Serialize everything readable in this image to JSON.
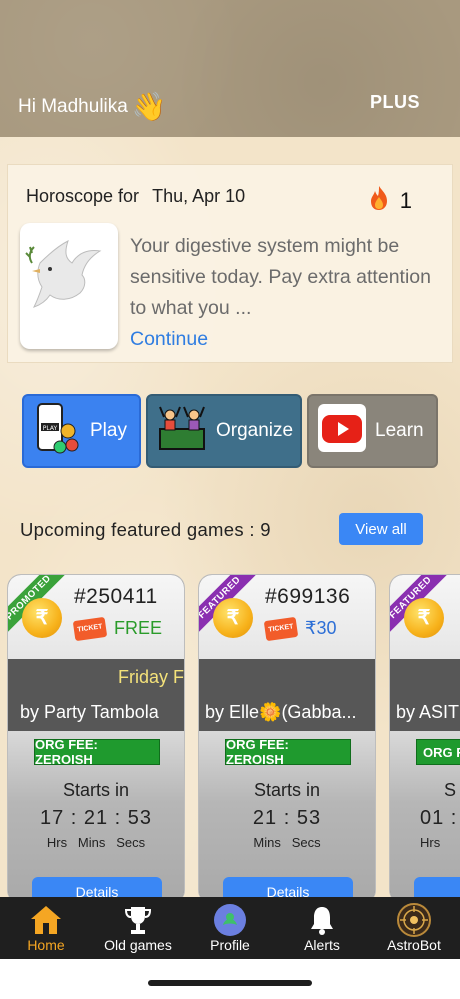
{
  "header": {
    "greeting": "Hi Madhulika",
    "wave": "👋",
    "plus_label": "PLUS"
  },
  "horoscope": {
    "title_prefix": "Horoscope for",
    "date": "Thu, Apr 10",
    "streak_icon": "fire-icon",
    "streak_count": "1",
    "text": "Your digestive system might be sensitive today. Pay extra attention to what you ...",
    "continue_label": "Continue"
  },
  "actions": [
    {
      "label": "Play",
      "icon": "play-phone-icon",
      "color": "#3b82f0"
    },
    {
      "label": "Organize",
      "icon": "organize-crowd-icon",
      "color": "#3f6f8a"
    },
    {
      "label": "Learn",
      "icon": "youtube-icon",
      "color": "#8a857b"
    }
  ],
  "upcoming": {
    "title": "Upcoming featured games : 9",
    "view_all_label": "View all"
  },
  "cards": [
    {
      "ribbon": "PROMOTED",
      "id": "#250411",
      "price": "FREE",
      "name": "Friday F",
      "host": "by Party Tambola",
      "org_fee": "ORG FEE: ZEROISH",
      "starts_label": "Starts in",
      "timer": "17 : 21 : 53",
      "units": "Hrs   Mins   Secs",
      "details_label": "Details"
    },
    {
      "ribbon": "FEATURED",
      "id": "#699136",
      "price": "₹30",
      "name": "",
      "host": "by Elle🌼(Gabba...",
      "org_fee": "ORG FEE: ZEROISH",
      "starts_label": "Starts in",
      "timer": "21 : 53",
      "units": "Mins   Secs",
      "details_label": "Details"
    },
    {
      "ribbon": "FEATURED",
      "id": "",
      "price": "",
      "name": "",
      "host": "by ASIT",
      "org_fee": "ORG F",
      "starts_label": "S",
      "timer": "01 :",
      "units": "Hrs",
      "details_label": ""
    }
  ],
  "nav": [
    {
      "label": "Home",
      "icon": "home-icon",
      "active": true
    },
    {
      "label": "Old games",
      "icon": "trophy-icon",
      "active": false
    },
    {
      "label": "Profile",
      "icon": "profile-avatar-icon",
      "active": false
    },
    {
      "label": "Alerts",
      "icon": "bell-icon",
      "active": false
    },
    {
      "label": "AstroBot",
      "icon": "astrobot-icon",
      "active": false
    }
  ]
}
